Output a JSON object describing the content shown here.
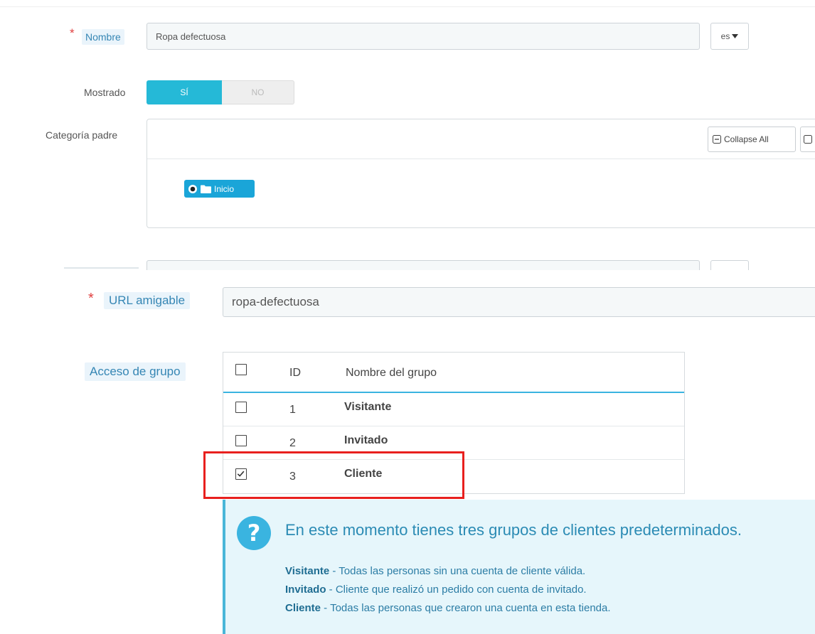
{
  "form": {
    "name": {
      "label": "Nombre",
      "value": "Ropa defectuosa",
      "lang": "es"
    },
    "displayed": {
      "label": "Mostrado",
      "yes": "SÍ",
      "no": "NO",
      "selected": "SÍ"
    },
    "parent_category": {
      "label": "Categoría padre",
      "collapse_all": "Collapse All",
      "root_node": "Inicio"
    },
    "friendly_url": {
      "label": "URL amigable",
      "value": "ropa-defectuosa"
    },
    "group_access": {
      "label": "Acceso de grupo",
      "columns": {
        "id": "ID",
        "name": "Nombre del grupo"
      },
      "rows": [
        {
          "id": "1",
          "name": "Visitante",
          "checked": false
        },
        {
          "id": "2",
          "name": "Invitado",
          "checked": false
        },
        {
          "id": "3",
          "name": "Cliente",
          "checked": true
        }
      ]
    }
  },
  "info": {
    "title": "En este momento tienes tres grupos de clientes predeterminados.",
    "lines": [
      {
        "term": "Visitante",
        "text": " - Todas las personas sin una cuenta de cliente válida."
      },
      {
        "term": "Invitado",
        "text": " - Cliente que realizó un pedido con cuenta de invitado."
      },
      {
        "term": "Cliente",
        "text": " - Todas las personas que crearon una cuenta en esta tienda."
      }
    ]
  },
  "colors": {
    "accent": "#25b9d7",
    "label_chip_bg": "#eaf4fb",
    "required": "#e04040",
    "highlight": "#e8201e",
    "info_bg": "#e6f6fb"
  }
}
